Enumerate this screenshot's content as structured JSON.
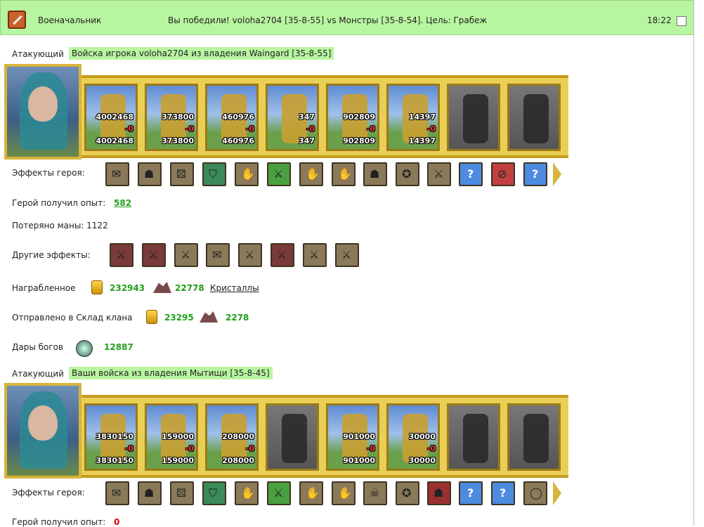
{
  "header": {
    "title": "Военачальник",
    "message": "Вы победили! voloha2704 [35-8-55] vs Монстры [35-8-54]. Цель: Грабеж",
    "time": "18:22"
  },
  "attacker1": {
    "label": "Атакующий",
    "tag": "Войска игрока voloha2704 из владения Waingard [35-8-55]",
    "units": [
      {
        "a": "4002468",
        "b": "-0",
        "c": "4002468"
      },
      {
        "a": "373800",
        "b": "-0",
        "c": "373800"
      },
      {
        "a": "460976",
        "b": "-0",
        "c": "460976"
      },
      {
        "a": "347",
        "b": "-0",
        "c": "347"
      },
      {
        "a": "902809",
        "b": "-0",
        "c": "902809"
      },
      {
        "a": "14397",
        "b": "-0",
        "c": "14397"
      }
    ],
    "effects_label": "Эффекты героя:",
    "exp_label": "Герой получил опыт:",
    "exp_value": "582",
    "mana_label": "Потеряно маны: 1122",
    "other_label": "Другие эффекты:",
    "loot_label": "Награбленное",
    "loot_gold": "232943",
    "loot_cryst": "22778",
    "loot_link": "Кристаллы",
    "clan_label": "Отправлено в Склад клана",
    "clan_gold": "23295",
    "clan_cryst": "2278",
    "gods_label": "Дары богов",
    "gods_value": "12887"
  },
  "attacker2": {
    "label": "Атакующий",
    "tag": "Ваши войска из владения Мытищи [35-8-45]",
    "units": [
      {
        "a": "3830150",
        "b": "-0",
        "c": "3830150"
      },
      {
        "a": "159000",
        "b": "-0",
        "c": "159000"
      },
      {
        "a": "208000",
        "b": "-0",
        "c": "208000"
      },
      {
        "a": "",
        "b": "",
        "c": ""
      },
      {
        "a": "901000",
        "b": "-0",
        "c": "901000"
      },
      {
        "a": "30000",
        "b": "-0",
        "c": "30000"
      }
    ],
    "effects_label": "Эффекты героя:",
    "exp_label": "Герой получил опыт:",
    "exp_value": "0"
  },
  "question_mark": "?"
}
